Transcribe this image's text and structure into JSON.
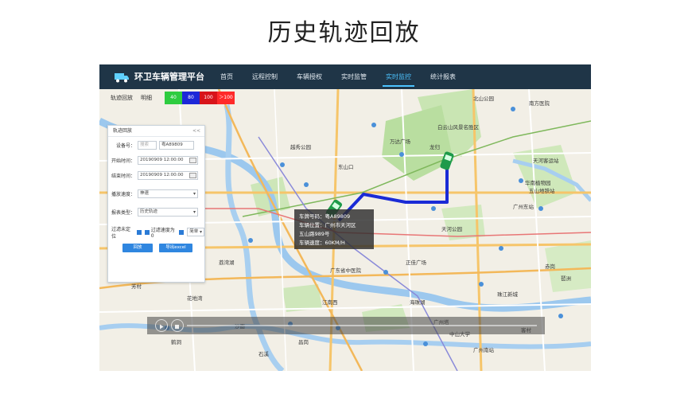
{
  "page": {
    "title": "历史轨迹回放"
  },
  "app": {
    "brand": "环卫车辆管理平台",
    "nav": [
      {
        "label": "首页",
        "active": false
      },
      {
        "label": "远程控制",
        "active": false
      },
      {
        "label": "车辆授权",
        "active": false
      },
      {
        "label": "实时监管",
        "active": false
      },
      {
        "label": "实时监控",
        "active": true
      },
      {
        "label": "统计报表",
        "active": false
      }
    ]
  },
  "trackbar": {
    "label1": "轨迹回放",
    "label2": "明细",
    "legend": [
      {
        "label": "40",
        "color": "#2ecc40"
      },
      {
        "label": "80",
        "color": "#1d28d8"
      },
      {
        "label": "100",
        "color": "#d8141a"
      },
      {
        "label": "＞100",
        "color": "#ff2a2a"
      }
    ]
  },
  "panel": {
    "title": "轨迹回放",
    "close": "<<",
    "device_label": "设备号：",
    "device_placeholder": "搜索",
    "device_value": "粤A89809",
    "start_label": "开始时间：",
    "start_value": "20190909 12:00:00",
    "end_label": "结束时间：",
    "end_value": "20190909 12:00:00",
    "speed_label": "播放速度：",
    "speed_value": "神速",
    "report_label": "报表类型：",
    "report_value": "历史轨迹",
    "filter_label": "过滤未定位",
    "filter_speed_label": "过滤速度为0",
    "filter_mode": "简单",
    "replay_button": "回放",
    "export_button": "导出excel"
  },
  "tooltip": {
    "plate": "车牌号码：粤A89809",
    "location1": "车辆位置：广州市天河区",
    "location2": "五山路989号",
    "speed": "车辆速度：60KM/H"
  },
  "map_labels": [
    "南方医院",
    "北山公园",
    "白云山风景名胜区",
    "万达广场",
    "龙归",
    "华南植物园",
    "天河客运站",
    "广州东站",
    "五山地铁站",
    "正佳广场",
    "天河公园",
    "广州塔",
    "珠江新城",
    "海珠湖",
    "广州南站",
    "东山口",
    "越秀公园",
    "荔湾湖",
    "沙面",
    "中山大学",
    "广东省中医院",
    "芳村",
    "花地湾",
    "鹤洞",
    "石溪",
    "昌岗",
    "江南西",
    "客村",
    "赤岗",
    "琶洲"
  ],
  "colors": {
    "topbar": "#1f3547",
    "accent": "#4cc3ff",
    "route": "#1a2bd6"
  }
}
